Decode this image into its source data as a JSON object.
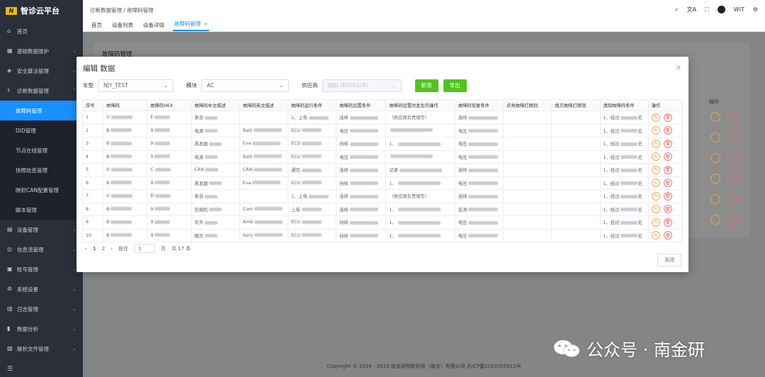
{
  "app": {
    "title": "智诊云平台",
    "logo_mark": "N"
  },
  "sidebar": {
    "items": [
      {
        "label": "首页",
        "icon": "home-icon"
      },
      {
        "label": "基础数据维护",
        "icon": "grid-icon"
      },
      {
        "label": "安全算法管理",
        "icon": "shield-icon"
      },
      {
        "label": "诊断数据管理",
        "icon": "diag-icon"
      },
      {
        "label": "故障码管理",
        "sub": true,
        "active": true
      },
      {
        "label": "DID管理",
        "sub": true
      },
      {
        "label": "节点在线管理",
        "sub": true
      },
      {
        "label": "快照信息管理",
        "sub": true
      },
      {
        "label": "映射CAN配置管理",
        "sub": true
      },
      {
        "label": "脚本管理",
        "sub": true
      },
      {
        "label": "设备管理",
        "icon": "device-icon"
      },
      {
        "label": "信息流管理",
        "icon": "chat-icon"
      },
      {
        "label": "账号管理",
        "icon": "user-icon"
      },
      {
        "label": "系统设置",
        "icon": "gear-icon"
      },
      {
        "label": "日志管理",
        "icon": "log-icon"
      },
      {
        "label": "数据分析",
        "icon": "chart-icon"
      },
      {
        "label": "解析文件管理",
        "icon": "file-icon"
      }
    ],
    "collapse_icon": "☰"
  },
  "header": {
    "breadcrumb": "诊断数据管理 / 故障码管理",
    "user": "WIT"
  },
  "tabs": [
    {
      "label": "首页"
    },
    {
      "label": "设备列表"
    },
    {
      "label": "设备详情"
    },
    {
      "label": "故障码管理",
      "active": true,
      "close": "×"
    }
  ],
  "page": {
    "title": "故障码管理",
    "bg_op_header": "操作"
  },
  "modal": {
    "title": "编辑 数据",
    "close": "×",
    "filters": {
      "car_label": "车型",
      "car_value": "NJY_TEST",
      "module_label": "模块",
      "module_value": "AC",
      "supplier_label": "供应商",
      "supplier_value": "瑞阳 (8500328)"
    },
    "add_button": "新增",
    "export_button": "导出",
    "columns": [
      "序号",
      "故障码",
      "故障码HEX",
      "故障码中文描述",
      "故障码英文描述",
      "故障码运行条件",
      "故障码设置条件",
      "故障码设置时发生的操作",
      "故障码恢复条件",
      "点亮故障灯原则",
      "熄灭故障灯原则",
      "清除故障码条件",
      "操作"
    ],
    "rows": [
      {
        "no": "1",
        "code": "U",
        "hex": "E",
        "cn": "来自",
        "en": "",
        "run": "1、上电",
        "set": "连续",
        "act": "（供应商负责填写）",
        "rec": "连续",
        "clr": "1、经过",
        "clr2": "无"
      },
      {
        "no": "2",
        "code": "B",
        "hex": "9",
        "cn": "电源",
        "en": "Batt",
        "run": "ECU",
        "set": "电压",
        "act": "",
        "rec": "电压",
        "clr": "1、经过",
        "clr2": "无"
      },
      {
        "no": "3",
        "code": "B",
        "hex": "9",
        "cn": "蒸发器",
        "en": "Eva",
        "run": "ECU",
        "set": "持续",
        "act": "1、",
        "rec": "电压",
        "clr": "1、经过",
        "clr2": "无"
      },
      {
        "no": "4",
        "code": "B",
        "hex": "9",
        "cn": "电源",
        "en": "Batt",
        "run": "ECU",
        "set": "电压",
        "act": "",
        "rec": "电压",
        "clr": "1、经过",
        "clr2": "无"
      },
      {
        "no": "5",
        "code": "U",
        "hex": "C",
        "cn": "CAN",
        "en": "CAN",
        "run": "通讯",
        "set": "连续",
        "act": "记录",
        "rec": "连续",
        "clr": "1、经过",
        "clr2": "无"
      },
      {
        "no": "6",
        "code": "B",
        "hex": "9",
        "cn": "蒸发器",
        "en": "Eva",
        "run": "ECU",
        "set": "持续",
        "act": "1、",
        "rec": "电压",
        "clr": "1、经过",
        "clr2": "无"
      },
      {
        "no": "7",
        "code": "U",
        "hex": "D",
        "cn": "来自",
        "en": "",
        "run": "1、上电",
        "set": "连续",
        "act": "（供应商负责填写）",
        "rec": "连续",
        "clr": "1、经过",
        "clr2": "无"
      },
      {
        "no": "8",
        "code": "B",
        "hex": "9",
        "cn": "压缩机",
        "en": "Com",
        "run": "上电",
        "set": "连续",
        "act": "1、",
        "rec": "监测",
        "clr": "1、经过",
        "clr2": "无"
      },
      {
        "no": "9",
        "code": "B",
        "hex": "9",
        "cn": "车外",
        "en": "Amb",
        "run": "ECU",
        "set": "持续",
        "act": "1、",
        "rec": "电压",
        "clr": "1、经过",
        "clr2": "无"
      },
      {
        "no": "10",
        "code": "B",
        "hex": "9",
        "cn": "模式",
        "en": "Serv",
        "run": "ECU",
        "set": "持续",
        "act": "1、",
        "rec": "电压",
        "clr": "1、经过",
        "clr2": "无"
      }
    ],
    "pager": {
      "prev": "‹",
      "pages": [
        "1",
        "2"
      ],
      "next": "›",
      "goto": "前往",
      "page_input": "1",
      "page_unit": "页",
      "total": "共 17 条"
    },
    "close_button": "关闭"
  },
  "footer": "Copyright © 2024 - 2025 南金研院新科技（南京）有限公司   苏ICP备2023055513号",
  "watermark": "公众号 · 南金研"
}
